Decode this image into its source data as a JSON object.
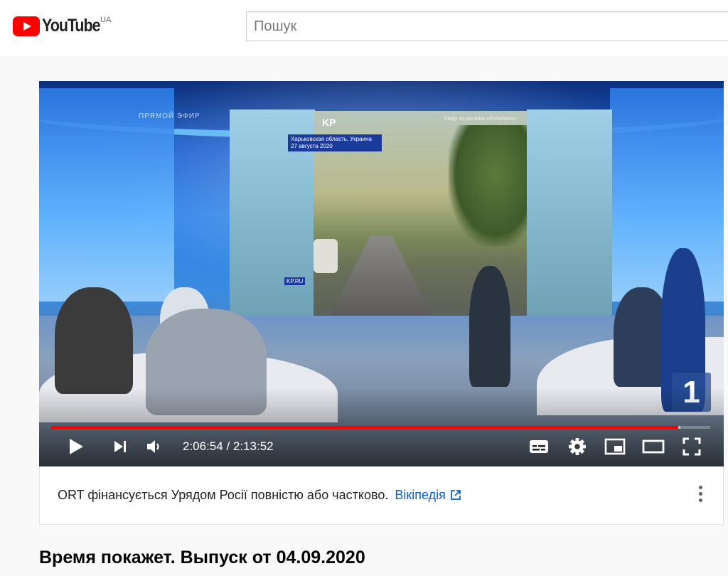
{
  "header": {
    "logo_text": "YouTube",
    "region": "UA",
    "search_placeholder": "Пошук"
  },
  "player": {
    "overlay": {
      "live_badge": "ПРЯМОЙ ЭФИР",
      "kp_logo": "KP",
      "location_caption": "Харьковская область, Украина 27 августа 2020",
      "credit": "Кадр из ролика «Kotsnews»",
      "kp_ru": "KP.RU",
      "channel_logo": "1"
    },
    "progress": {
      "played_fraction": 0.951,
      "buffered_fraction": 0.955
    },
    "time": {
      "current": "2:06:54",
      "separator": " / ",
      "duration": "2:13:52"
    },
    "accent_color": "#ff0000"
  },
  "notice": {
    "text": "ORT фінансується Урядом Росії повністю або частково.",
    "link_label": "Вікіпедія"
  },
  "video": {
    "title": "Время покажет. Выпуск от 04.09.2020"
  }
}
